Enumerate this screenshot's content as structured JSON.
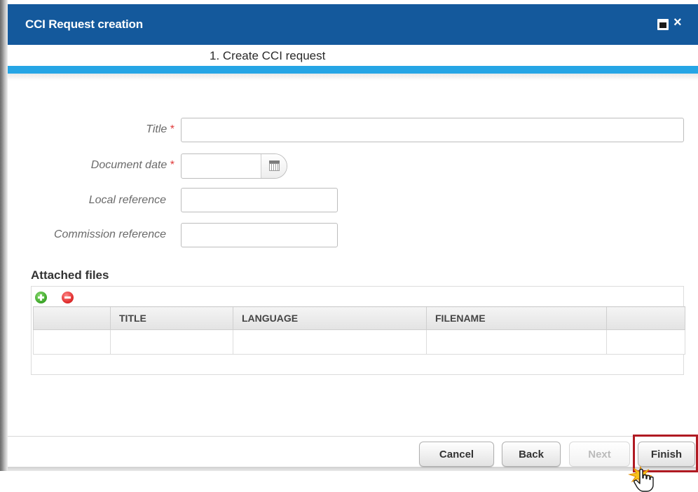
{
  "dialog": {
    "title": "CCI Request creation",
    "maximize_icon": "maximize-icon",
    "close_label": "×"
  },
  "wizard": {
    "step_label": "1. Create CCI request"
  },
  "form": {
    "title_label": "Title",
    "title_value": "",
    "document_date_label": "Document date",
    "document_date_value": "",
    "local_reference_label": "Local reference",
    "local_reference_value": "",
    "commission_reference_label": "Commission reference",
    "commission_reference_value": "",
    "required_marker": "*"
  },
  "attached_files": {
    "section_title": "Attached files",
    "add_icon": "add-circle-icon",
    "remove_icon": "remove-circle-icon",
    "columns": [
      "",
      "TITLE",
      "LANGUAGE",
      "FILENAME",
      ""
    ],
    "rows": []
  },
  "footer": {
    "cancel_label": "Cancel",
    "back_label": "Back",
    "next_label": "Next",
    "finish_label": "Finish"
  },
  "colors": {
    "titlebar": "#14599c",
    "progress": "#25a5e5",
    "required": "#e03a3a",
    "highlight": "#b01a22"
  }
}
